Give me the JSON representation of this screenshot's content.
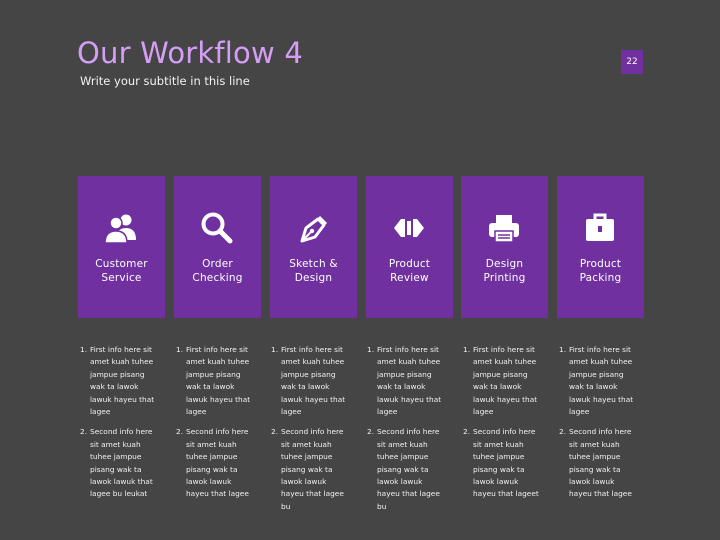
{
  "slide": {
    "title": "Our Workflow 4",
    "subtitle": "Write your subtitle in this line",
    "page_number": "22"
  },
  "colors": {
    "background": "#454545",
    "accent": "#7030a0",
    "title": "#d59ef5",
    "text": "#f2f2f2"
  },
  "cards": [
    {
      "icon": "users-icon",
      "label_line1": "Customer",
      "label_line2": "Service"
    },
    {
      "icon": "magnifier-icon",
      "label_line1": "Order",
      "label_line2": "Checking"
    },
    {
      "icon": "pen-nib-icon",
      "label_line1": "Sketch &",
      "label_line2": "Design"
    },
    {
      "icon": "arrows-code-icon",
      "label_line1": "Product",
      "label_line2": "Review"
    },
    {
      "icon": "printer-icon",
      "label_line1": "Design",
      "label_line2": "Printing"
    },
    {
      "icon": "briefcase-icon",
      "label_line1": "Product",
      "label_line2": "Packing"
    }
  ],
  "columns": [
    {
      "item1": {
        "num": "1.",
        "lines": [
          "First info here sit",
          "amet kuah tuhee",
          "jampue pisang",
          "wak ta lawok",
          "lawuk hayeu that",
          "lagee"
        ]
      },
      "item2": {
        "num": "2.",
        "lines": [
          "Second info here",
          "sit amet kuah",
          "tuhee jampue",
          "pisang wak ta",
          "lawok lawuk  that",
          "lagee bu leukat"
        ]
      }
    },
    {
      "item1": {
        "num": "1.",
        "lines": [
          "First info here sit",
          "amet kuah tuhee",
          "jampue pisang",
          "wak ta lawok",
          "lawuk hayeu that",
          "lagee"
        ]
      },
      "item2": {
        "num": "2.",
        "lines": [
          "Second info here",
          "sit amet kuah",
          "tuhee jampue",
          "pisang wak ta",
          "lawok lawuk",
          "hayeu that lagee"
        ]
      }
    },
    {
      "item1": {
        "num": "1.",
        "lines": [
          "First info here sit",
          "amet kuah tuhee",
          "jampue pisang",
          "wak ta lawok",
          "lawuk hayeu that",
          "lagee"
        ]
      },
      "item2": {
        "num": "2.",
        "lines": [
          "Second info here",
          "sit amet kuah",
          "tuhee jampue",
          "pisang wak ta",
          "lawok lawuk",
          "hayeu that lagee",
          "bu"
        ]
      }
    },
    {
      "item1": {
        "num": "1.",
        "lines": [
          "First info here sit",
          "amet kuah tuhee",
          "jampue pisang",
          "wak ta lawok",
          "lawuk hayeu that",
          "lagee"
        ]
      },
      "item2": {
        "num": "2.",
        "lines": [
          "Second info here",
          "sit amet kuah",
          "tuhee jampue",
          "pisang wak ta",
          "lawok lawuk",
          "hayeu that lagee",
          "bu"
        ]
      }
    },
    {
      "item1": {
        "num": "1.",
        "lines": [
          "First info here sit",
          "amet kuah tuhee",
          "jampue pisang",
          "wak ta lawok",
          "lawuk hayeu that",
          "lagee"
        ]
      },
      "item2": {
        "num": "2.",
        "lines": [
          "Second info here",
          "sit amet kuah",
          "tuhee jampue",
          "pisang wak ta",
          "lawok lawuk",
          "hayeu that lageet"
        ]
      }
    },
    {
      "item1": {
        "num": "1.",
        "lines": [
          "First info here sit",
          "amet kuah tuhee",
          "jampue pisang",
          "wak ta lawok",
          "lawuk hayeu that",
          "lagee"
        ]
      },
      "item2": {
        "num": "2.",
        "lines": [
          "Second info here",
          "sit amet kuah",
          "tuhee jampue",
          "pisang wak ta",
          "lawok lawuk",
          "hayeu that lagee"
        ]
      }
    }
  ]
}
